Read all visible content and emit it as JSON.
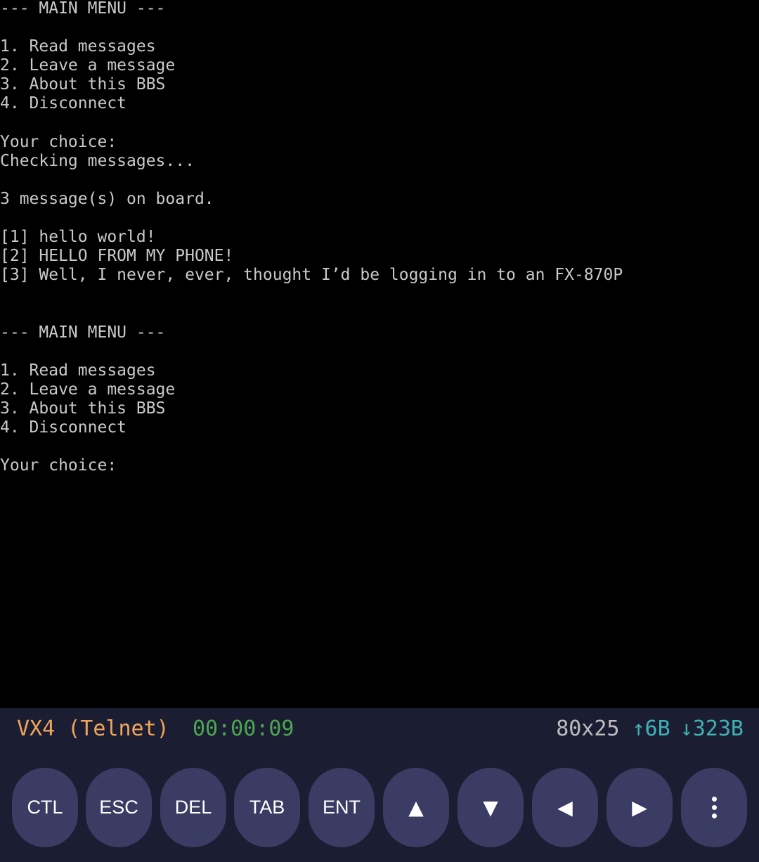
{
  "terminal": {
    "lines": [
      "--- MAIN MENU ---",
      "",
      "1. Read messages",
      "2. Leave a message",
      "3. About this BBS",
      "4. Disconnect",
      "",
      "Your choice:",
      "Checking messages...",
      "",
      "3 message(s) on board.",
      "",
      "[1] hello world!",
      "[2] HELLO FROM MY PHONE!",
      "[3] Well, I never, ever, thought I’d be logging in to an FX-870P",
      "",
      "",
      "--- MAIN MENU ---",
      "",
      "1. Read messages",
      "2. Leave a message",
      "3. About this BBS",
      "4. Disconnect",
      "",
      "Your choice:"
    ]
  },
  "status": {
    "host": "VX4 (Telnet)",
    "timer": "00:00:09",
    "size": "80x25",
    "sent": "↑6B",
    "received": "↓323B"
  },
  "keys": {
    "ctl": "CTL",
    "esc": "ESC",
    "del": "DEL",
    "tab": "TAB",
    "ent": "ENT",
    "up": "▲",
    "down": "▼",
    "left": "◀",
    "right": "▶"
  },
  "colors": {
    "terminal_bg": "#000000",
    "terminal_fg": "#c9c9c9",
    "bar_bg": "#1b1d33",
    "key_bg": "#3b3c63",
    "host": "#f0a559",
    "timer": "#4aa84f",
    "traffic": "#3fb2b4"
  }
}
